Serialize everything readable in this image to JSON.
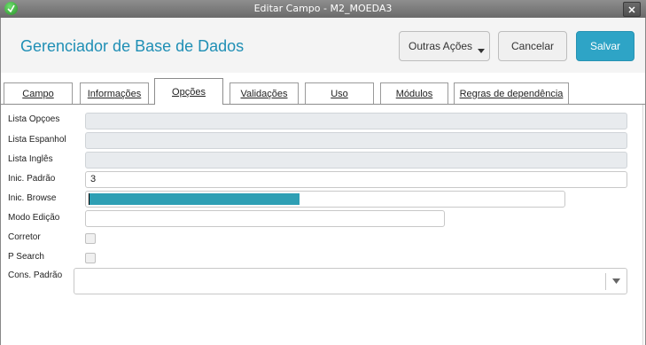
{
  "window": {
    "title": "Editar Campo - M2_MOEDA3"
  },
  "header": {
    "app_title": "Gerenciador de Base de Dados",
    "buttons": {
      "outras_acoes": "Outras Ações",
      "cancelar": "Cancelar",
      "salvar": "Salvar"
    }
  },
  "tabs": [
    {
      "label": "Campo",
      "active": false
    },
    {
      "label": "Informações",
      "active": false
    },
    {
      "label": "Opções",
      "active": true
    },
    {
      "label": "Validações",
      "active": false
    },
    {
      "label": "Uso",
      "active": false
    },
    {
      "label": "Módulos",
      "active": false
    },
    {
      "label": "Regras de dependência",
      "active": false
    }
  ],
  "form": {
    "lista_opcoes": {
      "label": "Lista Opçoes",
      "value": ""
    },
    "lista_espanhol": {
      "label": "Lista Espanhol",
      "value": ""
    },
    "lista_ingles": {
      "label": "Lista Inglês",
      "value": ""
    },
    "inic_padrao": {
      "label": "Inic. Padrão",
      "value": "3"
    },
    "inic_browse": {
      "label": "Inic. Browse",
      "value": ""
    },
    "modo_edicao": {
      "label": "Modo Edição",
      "value": ""
    },
    "corretor": {
      "label": "Corretor",
      "checked": false
    },
    "p_search": {
      "label": "P Search",
      "checked": false
    },
    "cons_padrao": {
      "label": "Cons. Padrão",
      "value": ""
    }
  },
  "colors": {
    "accent": "#1f8fb5",
    "primary_button": "#2ea4c6",
    "selection": "#2e9fb4"
  },
  "icons": [
    "app-logo-icon",
    "close-icon",
    "dropdown-caret-icon",
    "select-arrow-icon"
  ]
}
